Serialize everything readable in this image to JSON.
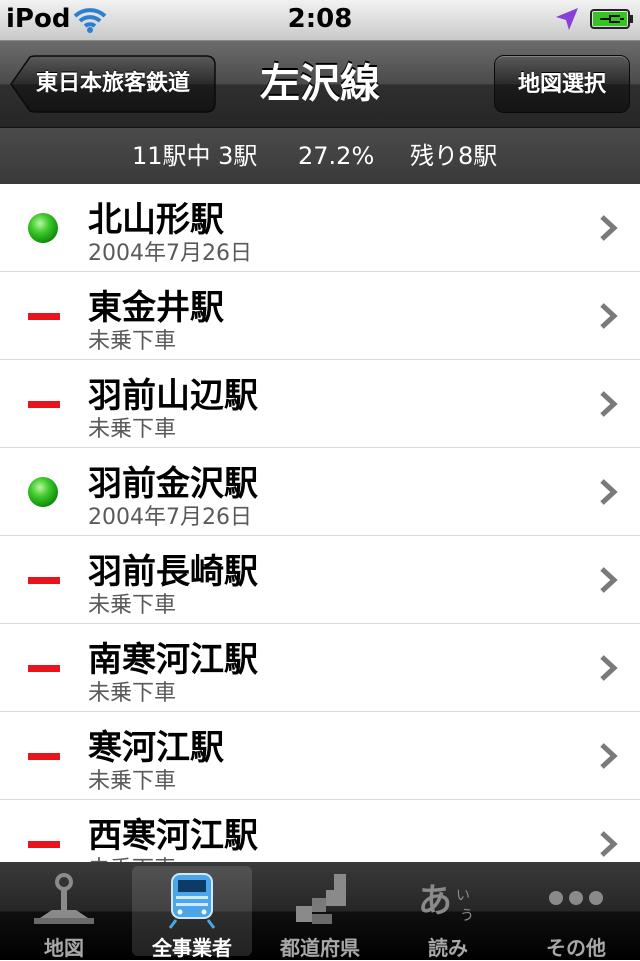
{
  "status": {
    "carrier": "iPod",
    "time": "2:08"
  },
  "nav": {
    "back_label": "東日本旅客鉄道",
    "title": "左沢線",
    "right_label": "地図選択"
  },
  "summary": {
    "counts": "11駅中 3駅",
    "percent": "27.2%",
    "remaining": "残り8駅"
  },
  "stations": [
    {
      "name": "北山形駅",
      "detail": "2004年7月26日",
      "status": "visited"
    },
    {
      "name": "東金井駅",
      "detail": "未乗下車",
      "status": "unvisited"
    },
    {
      "name": "羽前山辺駅",
      "detail": "未乗下車",
      "status": "unvisited"
    },
    {
      "name": "羽前金沢駅",
      "detail": "2004年7月26日",
      "status": "visited"
    },
    {
      "name": "羽前長崎駅",
      "detail": "未乗下車",
      "status": "unvisited"
    },
    {
      "name": "南寒河江駅",
      "detail": "未乗下車",
      "status": "unvisited"
    },
    {
      "name": "寒河江駅",
      "detail": "未乗下車",
      "status": "unvisited"
    },
    {
      "name": "西寒河江駅",
      "detail": "未乗下車",
      "status": "unvisited"
    }
  ],
  "tabs": [
    {
      "label": "地図",
      "icon": "joystick-icon",
      "selected": false
    },
    {
      "label": "全事業者",
      "icon": "train-icon",
      "selected": true
    },
    {
      "label": "都道府県",
      "icon": "blocks-icon",
      "selected": false
    },
    {
      "label": "読み",
      "icon": "kana-icon",
      "selected": false,
      "icon_text": "あいう"
    },
    {
      "label": "その他",
      "icon": "more-dots-icon",
      "selected": false
    }
  ],
  "colors": {
    "visited": "#1a9c16",
    "unvisited": "#e8141c",
    "selected_tab_icon": "#4aa6e8"
  }
}
